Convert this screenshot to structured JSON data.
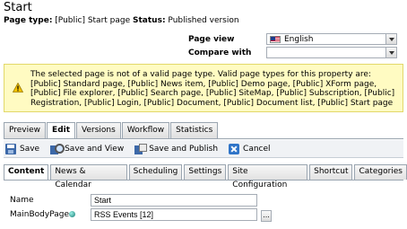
{
  "page": {
    "title": "Start",
    "page_type_label": "Page type:",
    "page_type_value": "[Public] Start page",
    "status_label": "Status:",
    "status_value": "Published version"
  },
  "view": {
    "page_view_label": "Page view",
    "page_view_value": "English",
    "compare_with_label": "Compare with",
    "compare_with_value": ""
  },
  "warning": {
    "icon": "warning-triangle-icon",
    "text": "The selected page is not of a valid page type. Valid page types for this property are: [Public] Standard page, [Public] News item, [Public] Demo page, [Public] XForm page, [Public] File explorer, [Public] Search page, [Public] SiteMap, [Public] Subscription, [Public] Registration, [Public] Login, [Public] Document, [Public] Document list, [Public] Start page"
  },
  "main_tabs": [
    {
      "label": "Preview"
    },
    {
      "label": "Edit"
    },
    {
      "label": "Versions"
    },
    {
      "label": "Workflow"
    },
    {
      "label": "Statistics"
    }
  ],
  "toolbar": {
    "save_label": "Save",
    "save_view_label": "Save and View",
    "save_publish_label": "Save and Publish",
    "cancel_label": "Cancel"
  },
  "edit_tabs": [
    {
      "label": "Content"
    },
    {
      "label": "News & Calendar"
    },
    {
      "label": "Scheduling"
    },
    {
      "label": "Settings"
    },
    {
      "label": "Site Configuration"
    },
    {
      "label": "Shortcut"
    },
    {
      "label": "Categories"
    }
  ],
  "fields": {
    "name_label": "Name",
    "name_value": "Start",
    "mainbody_label": "MainBodyPage",
    "mainbody_value": "RSS Events [12]",
    "browse_label": "..."
  }
}
